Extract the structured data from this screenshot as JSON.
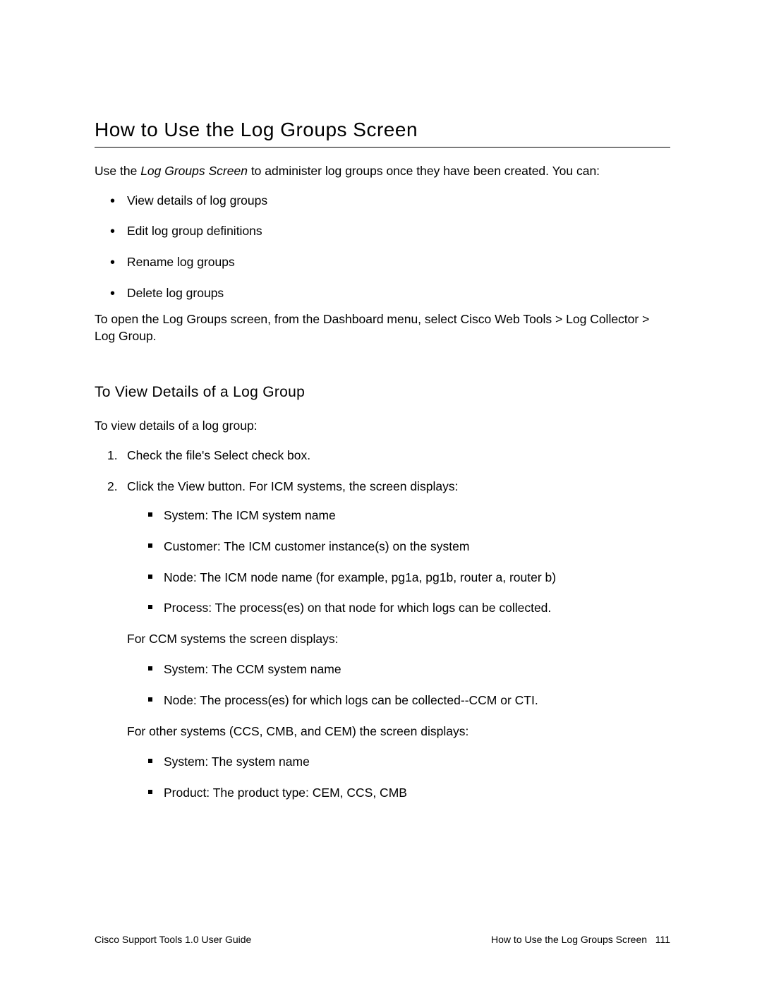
{
  "title": "How to Use the Log Groups Screen",
  "intro_pre": "Use the ",
  "intro_italic": "Log Groups Screen",
  "intro_post": " to administer log groups once they have been created. You can:",
  "bullets": {
    "b0": "View details of log groups",
    "b1": "Edit log group definitions",
    "b2": "Rename log groups",
    "b3": "Delete log groups"
  },
  "open_path": "To open the Log Groups screen, from the Dashboard menu, select Cisco Web Tools > Log Collector > Log Group.",
  "sub_heading": "To View Details of a Log Group",
  "sub_intro": "To view details of a log group:",
  "steps": {
    "s1": "Check the file's Select check box.",
    "s2": "Click the View button. For ICM systems, the screen displays:",
    "s2_items_icm": {
      "i0": "System: The ICM system name",
      "i1": "Customer: The ICM customer instance(s) on the system",
      "i2": "Node: The ICM node name (for example, pg1a, pg1b, router a, router b)",
      "i3": "Process: The process(es) on that node for which logs can be collected."
    },
    "s2_ccm_intro": "For CCM systems the screen displays:",
    "s2_items_ccm": {
      "i0": "System: The CCM system name",
      "i1": "Node: The process(es) for which logs can be collected--CCM or CTI."
    },
    "s2_other_intro": "For other systems (CCS, CMB, and CEM) the screen displays:",
    "s2_items_other": {
      "i0": "System: The system name",
      "i1": "Product: The product type: CEM, CCS, CMB"
    }
  },
  "footer": {
    "left": "Cisco Support Tools 1.0 User Guide",
    "right_title": "How to Use the Log Groups Screen",
    "right_page": "111"
  }
}
